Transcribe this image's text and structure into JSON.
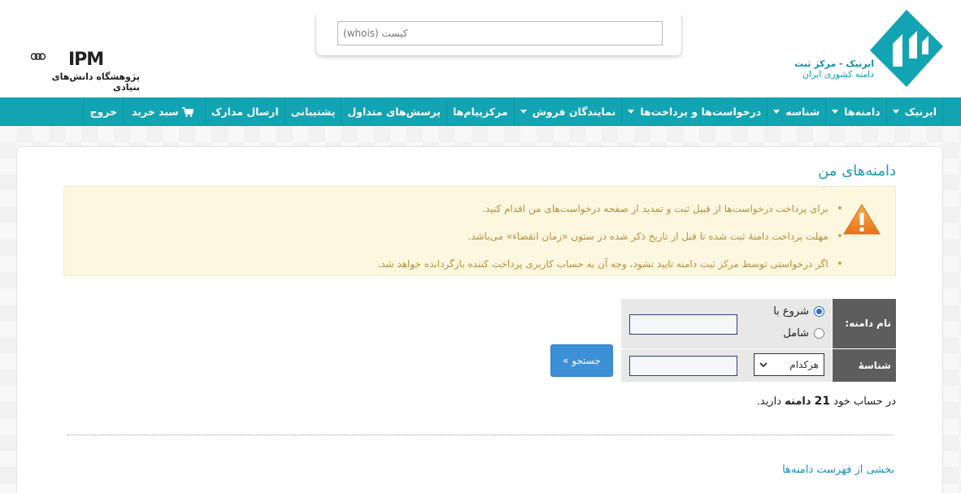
{
  "header": {
    "logo_line1": "ایرنیک - مرکز ثبت",
    "logo_line2": "دامنه کشوری ایران",
    "whois_placeholder": "کیست (whois)",
    "ipm_name": "IPM",
    "ipm_subtitle": "پژوهشگاه دانش‌های بنیادی"
  },
  "nav": {
    "items": [
      {
        "label": "ایرنیک",
        "dropdown": true
      },
      {
        "label": "دامنه‌ها",
        "dropdown": true
      },
      {
        "label": "شناسه",
        "dropdown": true
      },
      {
        "label": "درخواست‌ها و پرداخت‌ها",
        "dropdown": true
      },
      {
        "label": "نمایندگان فروش",
        "dropdown": true
      },
      {
        "label": "مرکزپیام‌ها",
        "dropdown": false
      },
      {
        "label": "پرسش‌های متداول",
        "dropdown": false
      },
      {
        "label": "پشتیبانی",
        "dropdown": false
      },
      {
        "label": "ارسال مدارک",
        "dropdown": false
      },
      {
        "label": "سبد خرید",
        "dropdown": false,
        "icon": "cart-icon"
      },
      {
        "label": "خروج",
        "dropdown": false
      }
    ]
  },
  "main": {
    "title": "دامنه‌های من",
    "alerts": [
      "برای پرداخت درخواست‌ها از قبیل ثبت و تمدید از صفحه درخواست‌های من اقدام کنید.",
      "مهلت پرداخت دامنهٔ ثبت شده تا قبل از تاریخ ذکر شده در ستون «زمان انقضاء» می‌باشد.",
      "اگر درخواستی توسط مرکز ثبت دامنه تایید نشود، وجه آن به حساب کاربری پرداخت کننده بازگردانده خواهد شد."
    ],
    "form": {
      "domain_label": "نام دامنه:",
      "contact_label": "شناسهٔ رابط:",
      "radio_starts": "شروع با",
      "radio_contains": "شامل",
      "select_value": "هرکدام",
      "search_button": "جستجو »"
    },
    "count": {
      "prefix": "در حساب خود",
      "number": "21",
      "word": "دامنه",
      "suffix": "دارید."
    },
    "section_link": "بخشی از فهرست دامنه‌ها"
  },
  "colors": {
    "nav_bg": "#12a4b2",
    "title": "#1a9db0",
    "alert_bg": "#fdf7e0",
    "alert_text": "#b8913a",
    "button": "#3d8fd6"
  }
}
